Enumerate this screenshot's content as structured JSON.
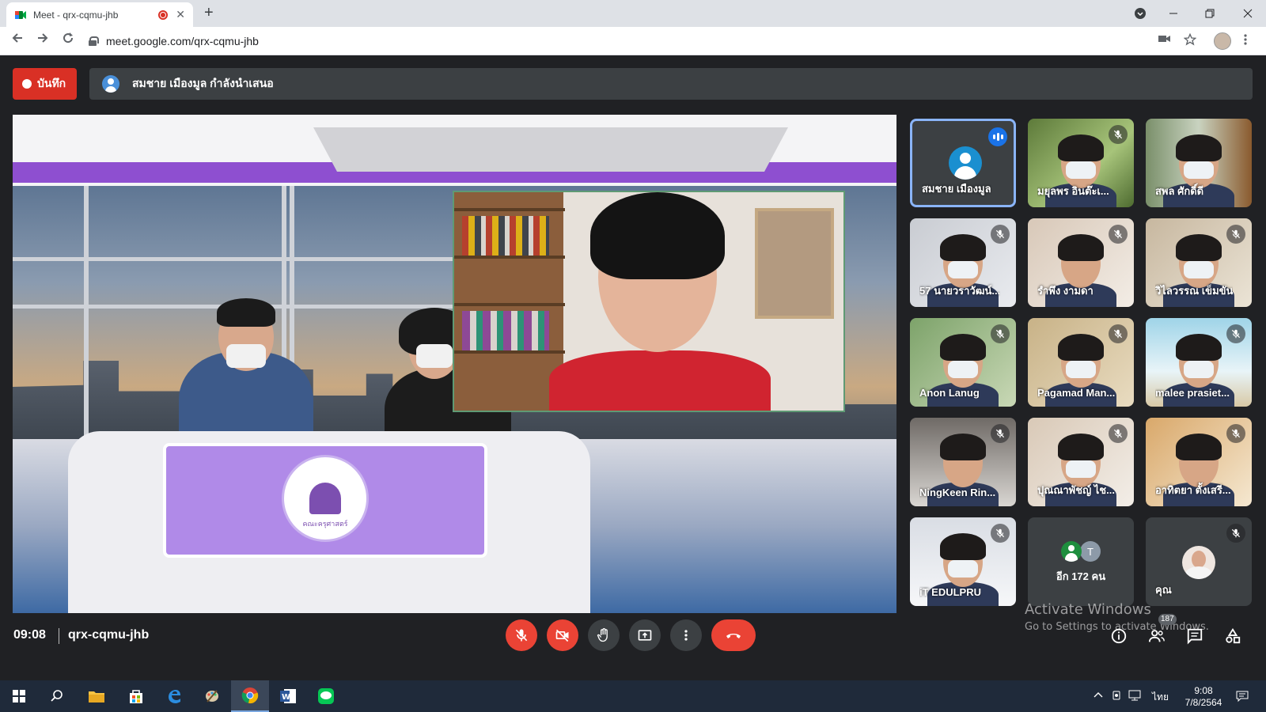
{
  "browser": {
    "tab_title": "Meet - qrx-cqmu-jhb",
    "tab_close": "✕",
    "new_tab": "+",
    "url": "meet.google.com/qrx-cqmu-jhb"
  },
  "meet": {
    "record_label": "บันทึก",
    "presenting_text": "สมชาย เมืองมูล กำลังนำเสนอ",
    "stage_logo_text": "คณะครุศาสตร์",
    "tiles": [
      {
        "name": "สมชาย เมืองมูล",
        "type": "avatar",
        "speaking": true
      },
      {
        "name": "มยุลพร อินต๊ะเ...",
        "type": "video",
        "muted": true
      },
      {
        "name": "สพล ศักดิ์ดี",
        "type": "video",
        "muted": false
      },
      {
        "name": "57 นายวราวัฒน์...",
        "type": "video",
        "muted": true
      },
      {
        "name": "รำพึง งามดา",
        "type": "video",
        "muted": true
      },
      {
        "name": "วิไลวรรณ เข็มขัน",
        "type": "video",
        "muted": true
      },
      {
        "name": "Anon Lanug",
        "type": "video",
        "muted": true
      },
      {
        "name": "Pagamad Man...",
        "type": "video",
        "muted": true
      },
      {
        "name": "malee prasiet...",
        "type": "video",
        "muted": true
      },
      {
        "name": "NingKeen Rin...",
        "type": "video",
        "muted": true
      },
      {
        "name": "ปุณณาพัชญ์ ไช...",
        "type": "video",
        "muted": true
      },
      {
        "name": "อาทิตยา ตั้งเสรี...",
        "type": "video",
        "muted": true
      },
      {
        "name": "iT EDULPRU",
        "type": "video",
        "muted": true
      },
      {
        "name": "อีก 172 คน",
        "type": "more",
        "initial": "T"
      },
      {
        "name": "คุณ",
        "type": "self",
        "muted": true
      }
    ],
    "time": "09:08",
    "meeting_code": "qrx-cqmu-jhb",
    "participants_count": "187",
    "watermark_title": "Activate Windows",
    "watermark_sub": "Go to Settings to activate Windows."
  },
  "taskbar": {
    "language": "ไทย",
    "clock_time": "9:08",
    "clock_date": "7/8/2564"
  }
}
